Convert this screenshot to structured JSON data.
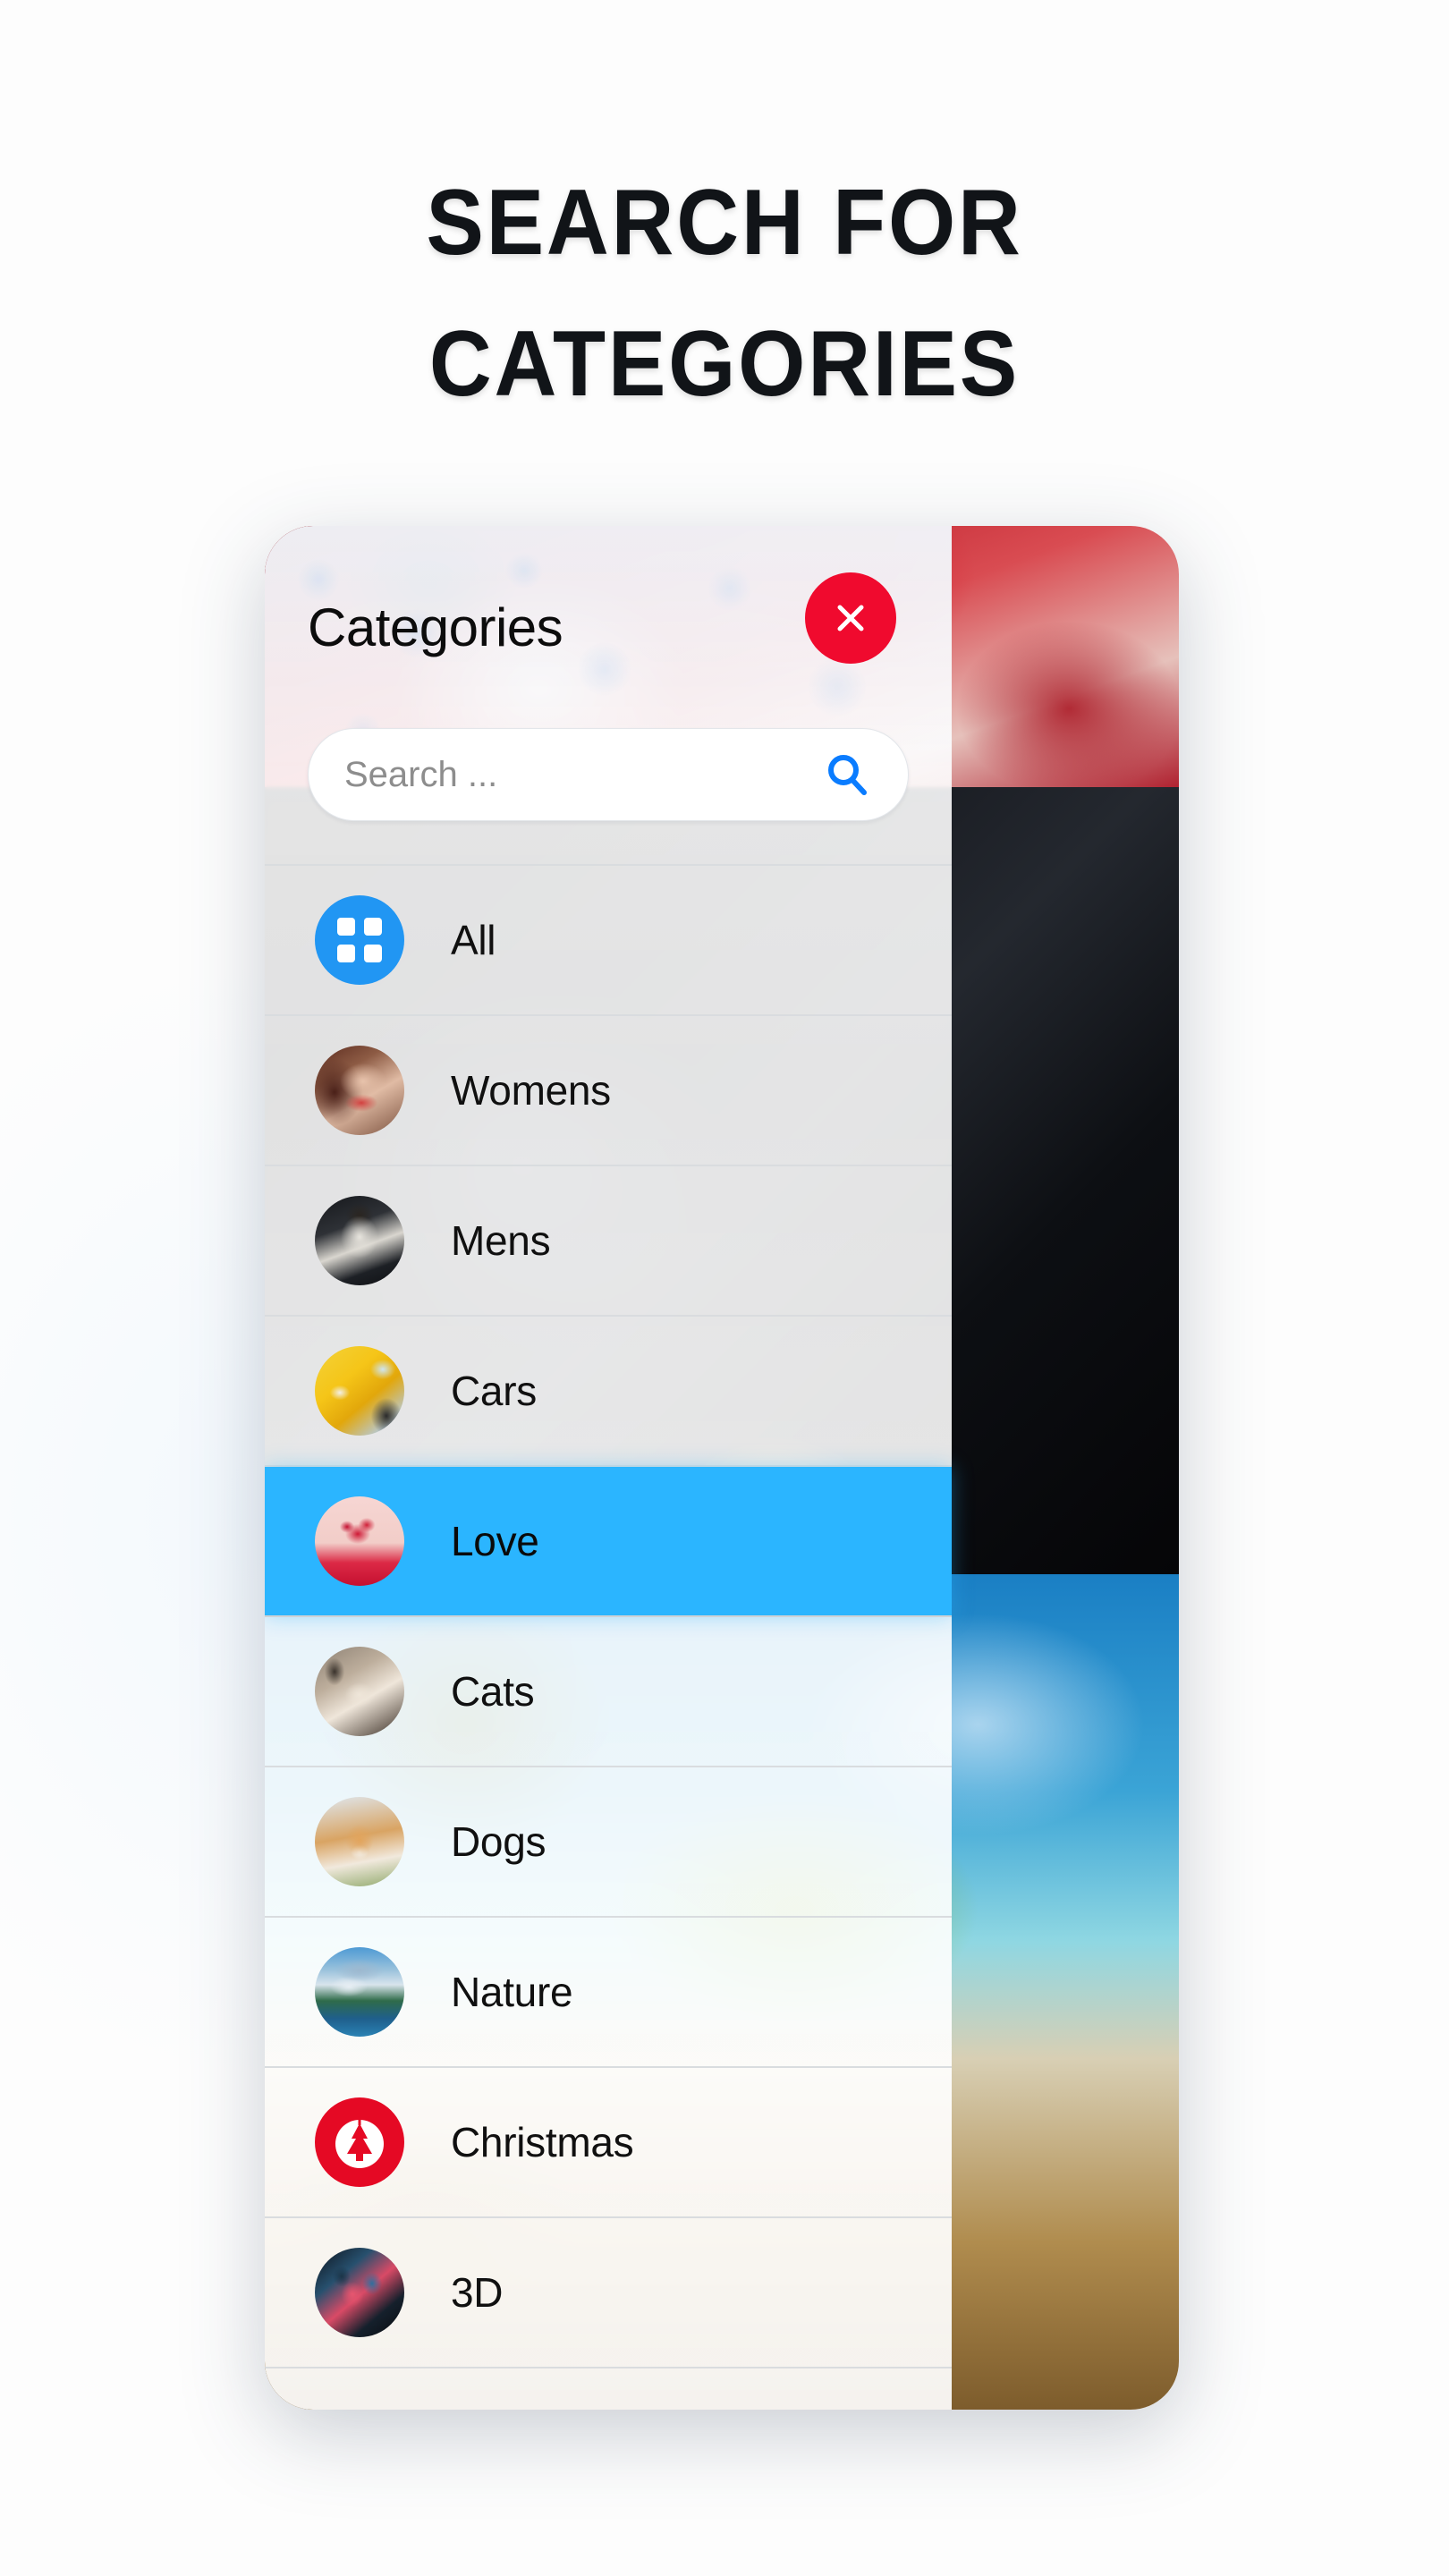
{
  "headline": {
    "line1": "SEARCH FOR",
    "line2": "CATEGORIES"
  },
  "panel": {
    "title": "Categories",
    "close_icon": "close-x-icon",
    "search": {
      "value": "",
      "placeholder": "Search ...",
      "icon": "search-magnifier-icon"
    }
  },
  "colors": {
    "accent_blue": "#2BB5FF",
    "icon_blue": "#2196F3",
    "search_icon_blue": "#0A7CFF",
    "close_red": "#F00A2E",
    "christmas_red": "#E50924",
    "text_dark": "#101010",
    "placeholder_gray": "#8D8D8D",
    "divider_gray": "#D9DCDF"
  },
  "categories": [
    {
      "label": "All",
      "icon": "grid-icon",
      "selected": false
    },
    {
      "label": "Womens",
      "icon": "womens-avatar-icon",
      "selected": false
    },
    {
      "label": "Mens",
      "icon": "mens-avatar-icon",
      "selected": false
    },
    {
      "label": "Cars",
      "icon": "cars-avatar-icon",
      "selected": false
    },
    {
      "label": "Love",
      "icon": "love-avatar-icon",
      "selected": true
    },
    {
      "label": "Cats",
      "icon": "cats-avatar-icon",
      "selected": false
    },
    {
      "label": "Dogs",
      "icon": "dogs-avatar-icon",
      "selected": false
    },
    {
      "label": "Nature",
      "icon": "nature-avatar-icon",
      "selected": false
    },
    {
      "label": "Christmas",
      "icon": "christmas-tree-icon",
      "selected": false
    },
    {
      "label": "3D",
      "icon": "threed-avatar-icon",
      "selected": false
    }
  ],
  "wallpapers": [
    {
      "name": "red-roses-wallpaper"
    },
    {
      "name": "black-cat-wallpaper"
    },
    {
      "name": "tropical-beach-wallpaper"
    }
  ]
}
